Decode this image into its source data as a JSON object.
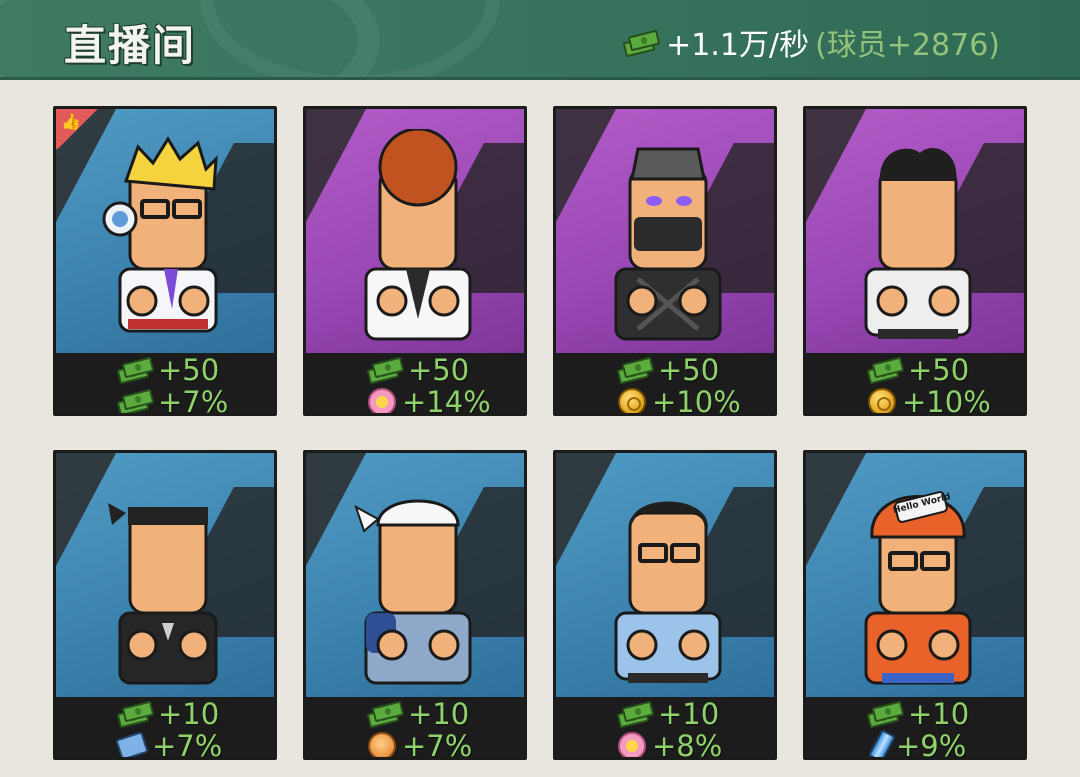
{
  "header": {
    "title": "直播间",
    "income_rate": "+1.1万/秒",
    "players_bonus": "(球员+2876)",
    "icon": "cash-icon"
  },
  "colors": {
    "header_bg": "#3f7a62",
    "stat_green": "#8fd26a",
    "players_green": "#93c27a",
    "card_blue": "#4f9bc4",
    "card_purple": "#b25bc7"
  },
  "cards": [
    {
      "bg": "blue",
      "liked": true,
      "character": "headphones-blond-glasses",
      "stat1": {
        "icon": "cash-icon",
        "value": "+50"
      },
      "stat2": {
        "icon": "cash-icon",
        "value": "+7%"
      }
    },
    {
      "bg": "purple",
      "liked": false,
      "character": "afro-white-suit",
      "stat1": {
        "icon": "cash-icon",
        "value": "+50"
      },
      "stat2": {
        "icon": "flower-icon",
        "value": "+14%"
      }
    },
    {
      "bg": "purple",
      "liked": false,
      "character": "masked-ninja",
      "stat1": {
        "icon": "cash-icon",
        "value": "+50"
      },
      "stat2": {
        "icon": "coin-icon",
        "value": "+10%"
      }
    },
    {
      "bg": "purple",
      "liked": false,
      "character": "slick-hair-shirt",
      "stat1": {
        "icon": "cash-icon",
        "value": "+50"
      },
      "stat2": {
        "icon": "coin-icon",
        "value": "+10%"
      }
    },
    {
      "bg": "blue",
      "liked": false,
      "character": "bandana-tanktop",
      "stat1": {
        "icon": "cash-icon",
        "value": "+10"
      },
      "stat2": {
        "icon": "card-icon",
        "value": "+7%"
      }
    },
    {
      "bg": "blue",
      "liked": false,
      "character": "white-headscarf-worker",
      "stat1": {
        "icon": "cash-icon",
        "value": "+10"
      },
      "stat2": {
        "icon": "thumb-icon",
        "value": "+7%"
      }
    },
    {
      "bg": "blue",
      "liked": false,
      "character": "glasses-blue-shirt",
      "stat1": {
        "icon": "cash-icon",
        "value": "+10"
      },
      "stat2": {
        "icon": "flower-icon",
        "value": "+8%"
      }
    },
    {
      "bg": "blue",
      "liked": false,
      "character": "helmet-hello-world",
      "helmet_text": "Hello World",
      "stat1": {
        "icon": "cash-icon",
        "value": "+10"
      },
      "stat2": {
        "icon": "can-icon",
        "value": "+9%"
      }
    }
  ]
}
